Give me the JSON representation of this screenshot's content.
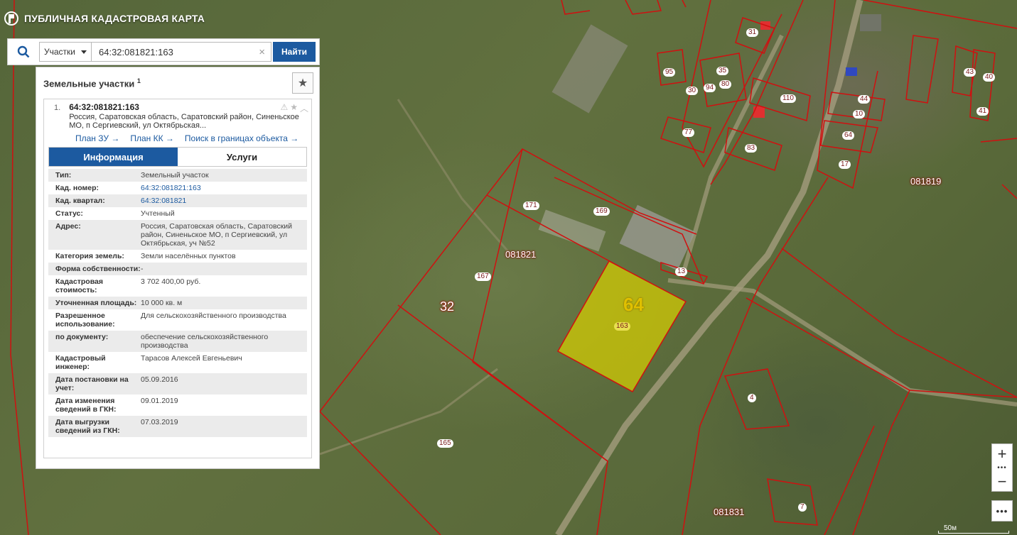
{
  "header": {
    "title": "ПУБЛИЧНАЯ КАДАСТРОВАЯ КАРТА"
  },
  "search": {
    "type_selected": "Участки",
    "query": "64:32:081821:163",
    "find_label": "Найти",
    "clear_label": "×"
  },
  "panel": {
    "title": "Земельные участки",
    "count": "1",
    "result": {
      "number": "1.",
      "cad_number": "64:32:081821:163",
      "address_short": "Россия, Саратовская область, Саратовский район, Синеньское МО, п Сергиевский, ул Октябрьская...",
      "links": [
        "План ЗУ →",
        "План КК →",
        "Поиск в границах объекта →"
      ],
      "tabs": [
        "Информация",
        "Услуги"
      ],
      "rows": [
        {
          "k": "Тип:",
          "v": "Земельный участок"
        },
        {
          "k": "Кад. номер:",
          "v": "64:32:081821:163",
          "link": true
        },
        {
          "k": "Кад. квартал:",
          "v": "64:32:081821",
          "link": true
        },
        {
          "k": "Статус:",
          "v": "Учтенный"
        },
        {
          "k": "Адрес:",
          "v": "Россия, Саратовская область, Саратовский район, Синеньское МО, п Сергиевский, ул Октябрьская, уч №52"
        },
        {
          "k": "Категория земель:",
          "v": "Земли населённых пунктов"
        },
        {
          "k": "Форма собственности:",
          "v": "-"
        },
        {
          "k": "Кадастровая стоимость:",
          "v": "3 702 400,00 руб."
        },
        {
          "k": "Уточненная площадь:",
          "v": "10 000 кв. м"
        },
        {
          "k": "Разрешенное использование:",
          "v": "Для сельскохозяйственного производства"
        },
        {
          "k": "по документу:",
          "v": "обеспечение сельскохозяйственного производства"
        },
        {
          "k": "Кадастровый инженер:",
          "v": "Тарасов Алексей Евгеньевич"
        },
        {
          "k": "Дата постановки на учет:",
          "v": "05.09.2016"
        },
        {
          "k": "Дата изменения сведений в ГКН:",
          "v": "09.01.2019"
        },
        {
          "k": "Дата выгрузки сведений из ГКН:",
          "v": "07.03.2019"
        }
      ]
    }
  },
  "map": {
    "parcel_labels": [
      "171",
      "169",
      "167",
      "165",
      "163",
      "13",
      "95",
      "30",
      "94",
      "35",
      "80",
      "77",
      "110",
      "83",
      "31",
      "44",
      "10",
      "64",
      "17",
      "4",
      "43",
      "40",
      "41",
      "7"
    ],
    "quarter_labels": [
      "081821",
      "081819",
      "081831"
    ],
    "district_label": "32",
    "highlight_label": "64",
    "highlight_color": "#d8d000",
    "boundary_color": "#d01010"
  },
  "controls": {
    "zoom_in": "+",
    "zoom_out": "−",
    "dots": "•••",
    "more": "•••",
    "scale": "50м"
  }
}
